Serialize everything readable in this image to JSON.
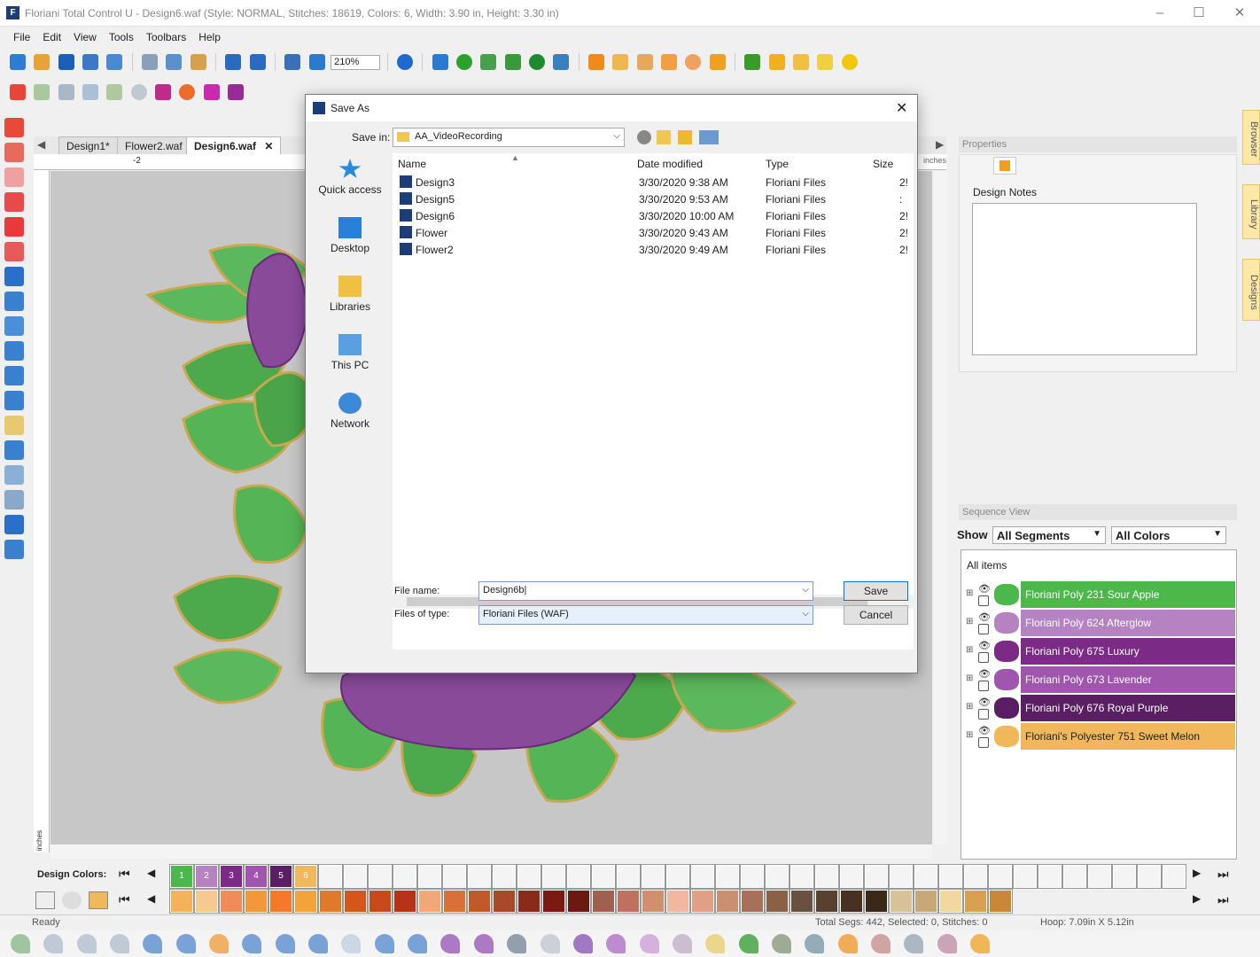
{
  "window": {
    "title": "Floriani Total Control U - Design6.waf (Style: NORMAL, Stitches: 18619, Colors: 6, Width: 3.90 in, Height: 3.30 in)"
  },
  "menu": [
    "File",
    "Edit",
    "View",
    "Tools",
    "Toolbars",
    "Help"
  ],
  "toolbar": {
    "zoom": "210%"
  },
  "tabs": [
    "Design1*",
    "Flower2.waf",
    "Design6.waf"
  ],
  "ruler": {
    "h_label": "-2",
    "unit": "inches",
    "v_unit": "inches"
  },
  "dialog": {
    "title": "Save As",
    "save_in_label": "Save in:",
    "save_in_value": "AA_VideoRecording",
    "places": [
      "Quick access",
      "Desktop",
      "Libraries",
      "This PC",
      "Network"
    ],
    "columns": {
      "name": "Name",
      "date": "Date modified",
      "type": "Type",
      "size": "Size"
    },
    "files": [
      {
        "name": "Design3",
        "date": "3/30/2020 9:38 AM",
        "type": "Floriani Files",
        "size": "2!"
      },
      {
        "name": "Design5",
        "date": "3/30/2020 9:53 AM",
        "type": "Floriani Files",
        "size": ":"
      },
      {
        "name": "Design6",
        "date": "3/30/2020 10:00 AM",
        "type": "Floriani Files",
        "size": "2!"
      },
      {
        "name": "Flower",
        "date": "3/30/2020 9:43 AM",
        "type": "Floriani Files",
        "size": "2!"
      },
      {
        "name": "Flower2",
        "date": "3/30/2020 9:49 AM",
        "type": "Floriani Files",
        "size": "2!"
      }
    ],
    "filename_label": "File name:",
    "filename_value": "Design6b|",
    "filetype_label": "Files of type:",
    "filetype_value": "Floriani Files (WAF)",
    "save_button": "Save",
    "cancel_button": "Cancel"
  },
  "properties": {
    "header": "Properties",
    "design_notes": "Design Notes"
  },
  "side_tabs": [
    "Browser",
    "Library",
    "Designs"
  ],
  "sequence": {
    "header": "Sequence View",
    "show_label": "Show",
    "segments": "All Segments",
    "colors": "All Colors",
    "all_items": "All items",
    "items": [
      {
        "label": "Floriani Poly 231 Sour Apple",
        "color": "#4cb84c"
      },
      {
        "label": "Floriani Poly 624 Afterglow",
        "color": "#b583c2"
      },
      {
        "label": "Floriani Poly 675 Luxury",
        "color": "#7b2a86"
      },
      {
        "label": "Floriani Poly 673 Lavender",
        "color": "#a056ad"
      },
      {
        "label": "Floriani Poly 676 Royal Purple",
        "color": "#5a1e63"
      },
      {
        "label": "Floriani's Polyester 751 Sweet Melon",
        "color": "#f0b85a"
      }
    ]
  },
  "design_colors": {
    "label": "Design Colors:",
    "swatches": [
      {
        "n": "1",
        "color": "#4cb84c"
      },
      {
        "n": "2",
        "color": "#b583c2"
      },
      {
        "n": "3",
        "color": "#7b2a86"
      },
      {
        "n": "4",
        "color": "#a056ad"
      },
      {
        "n": "5",
        "color": "#5a1e63"
      },
      {
        "n": "6",
        "color": "#f0b85a"
      }
    ]
  },
  "palette_colors": [
    "#f4b25a",
    "#f6c892",
    "#f08c5a",
    "#f0983a",
    "#f47a2a",
    "#f4a23a",
    "#e07a2a",
    "#d4561a",
    "#c84a1a",
    "#b8321a",
    "#f0a87a",
    "#d8703a",
    "#c05a2a",
    "#a84a2a",
    "#8a2a1a",
    "#7a1a12",
    "#6a1a10",
    "#a06050",
    "#c07060",
    "#d09070",
    "#f0b8a0",
    "#e0a088",
    "#c89070",
    "#a87058",
    "#8a6048",
    "#6a5040",
    "#5a4030",
    "#4a3020",
    "#3a2818",
    "#d8c098",
    "#c8a878",
    "#f0d8a0",
    "#d8a050",
    "#c88838"
  ],
  "status": {
    "ready": "Ready",
    "segs": "Total Segs: 442, Selected: 0, Stitches: 0",
    "hoop": "Hoop: 7.09in X 5.12in"
  }
}
